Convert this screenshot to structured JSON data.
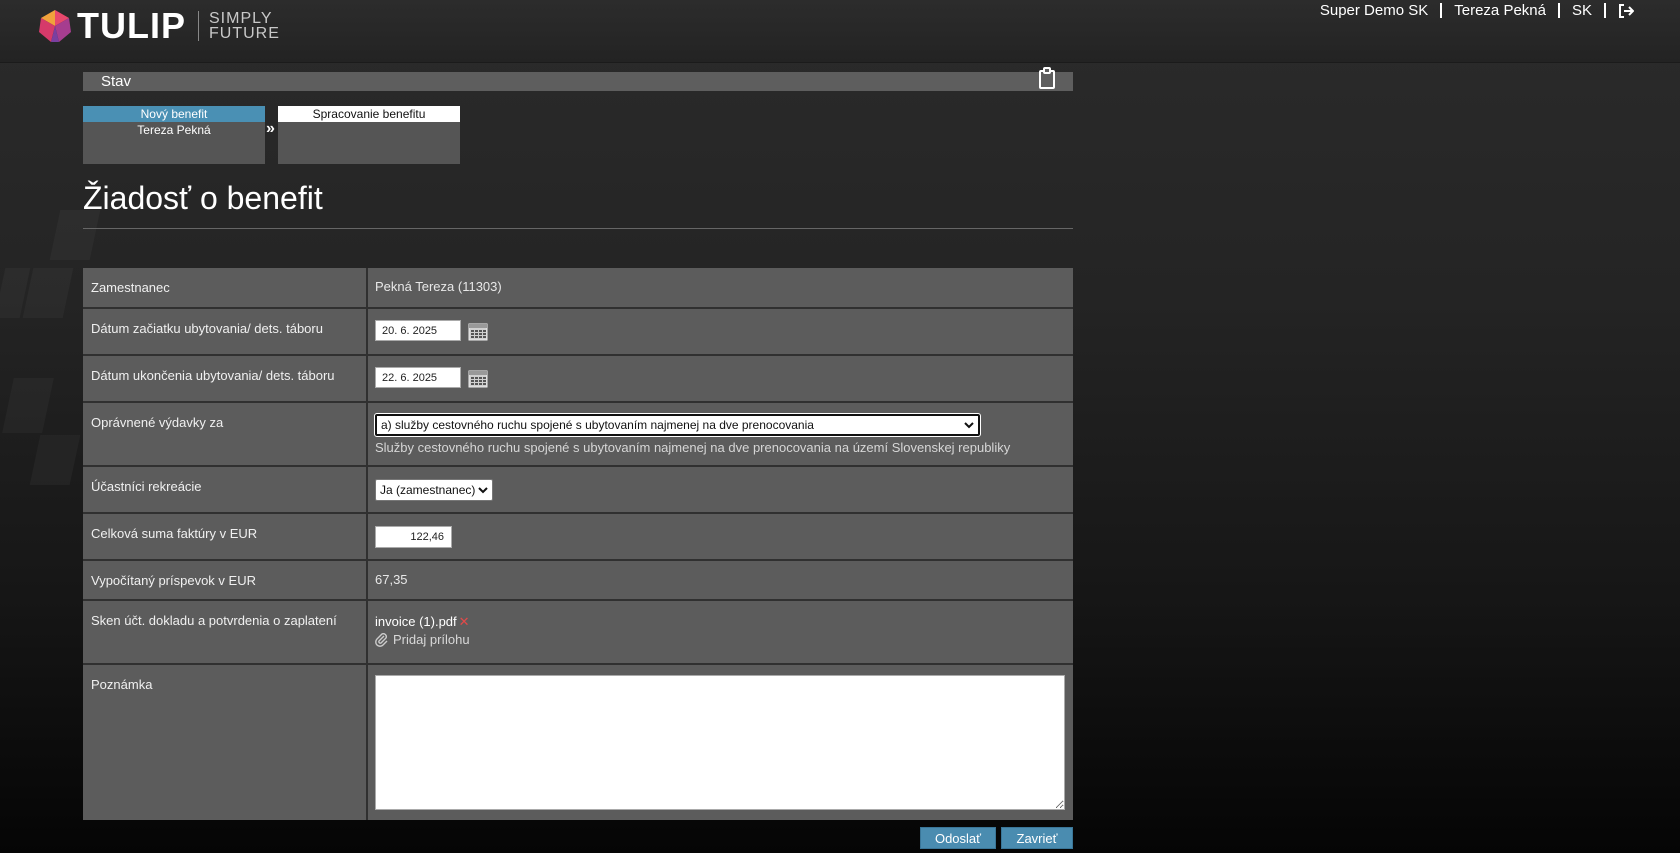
{
  "header": {
    "logo_text": "TULIP",
    "logo_tag_line1": "SIMPLY",
    "logo_tag_line2": "FUTURE",
    "nav": {
      "company": "Super Demo SK",
      "user": "Tereza Pekná",
      "language": "SK",
      "logout_icon": "logout-icon"
    }
  },
  "status": {
    "title": "Stav",
    "steps": [
      {
        "label": "Nový benefit",
        "sub": "Tereza Pekná",
        "active": true
      },
      {
        "label": "Spracovanie benefitu",
        "sub": "",
        "active": false
      }
    ],
    "arrow": "»"
  },
  "page": {
    "title": "Žiadosť o benefit"
  },
  "form": {
    "employee": {
      "label": "Zamestnanec",
      "value": "Pekná Tereza (11303)"
    },
    "start_date": {
      "label": "Dátum začiatku ubytovania/ dets. táboru",
      "value": "20. 6. 2025"
    },
    "end_date": {
      "label": "Dátum ukončenia ubytovania/ dets. táboru",
      "value": "22. 6. 2025"
    },
    "expenses": {
      "label": "Oprávnené výdavky za",
      "selected": "a) služby cestovného ruchu spojené s ubytovaním najmenej na dve prenocovania",
      "hint": "Služby cestovného ruchu spojené s ubytovaním najmenej na dve prenocovania na území Slovenskej republiky"
    },
    "participants": {
      "label": "Účastníci rekreácie",
      "selected": "Ja (zamestnanec)"
    },
    "invoice_total": {
      "label": "Celková suma faktúry v EUR",
      "value": "122,46"
    },
    "computed": {
      "label": "Vypočítaný príspevok v EUR",
      "value": "67,35"
    },
    "scan": {
      "label": "Sken účt. dokladu a potvrdenia o zaplatení",
      "file": "invoice (1).pdf",
      "remove": "✕",
      "add_attachment": "Pridaj prílohu"
    },
    "note": {
      "label": "Poznámka",
      "value": ""
    }
  },
  "buttons": {
    "send": "Odoslať",
    "close": "Zavrieť"
  },
  "colors": {
    "accent": "#4a8cb0",
    "active_step": "#4a90b4",
    "remove": "#e24a4a"
  }
}
